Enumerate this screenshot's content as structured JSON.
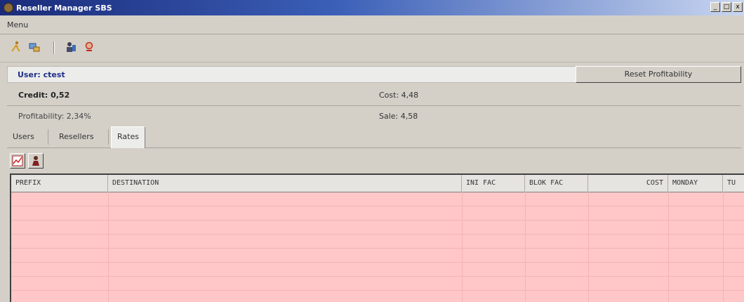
{
  "window": {
    "title": "Reseller Manager SBS",
    "btn_min": "_",
    "btn_max": "□",
    "btn_close": "x"
  },
  "menu": {
    "label": "Menu"
  },
  "toolbar": {
    "icons": [
      "person-run-icon",
      "network-icon",
      "user-config-icon",
      "user-search-icon"
    ]
  },
  "user": {
    "label": "User: ctest"
  },
  "reset_button": "Reset Profitability",
  "info": {
    "credit": "Credit: 0,52",
    "cost": "Cost: 4,48",
    "profitability": "Profitability: 2,34%",
    "sale": "Sale: 4,58"
  },
  "tabs": [
    "Users",
    "Resellers",
    "Rates"
  ],
  "active_tab": "Rates",
  "subtools": [
    "chart-icon",
    "person-icon"
  ],
  "table": {
    "columns": [
      "PREFIX",
      "DESTINATION",
      "INI FAC",
      "BLOK FAC",
      "COST",
      "MONDAY",
      "TU"
    ],
    "rows": []
  },
  "colors": {
    "grid_bg": "#ffc7c7",
    "title_start": "#1a2b7a",
    "user_text": "#1f2f8a"
  }
}
